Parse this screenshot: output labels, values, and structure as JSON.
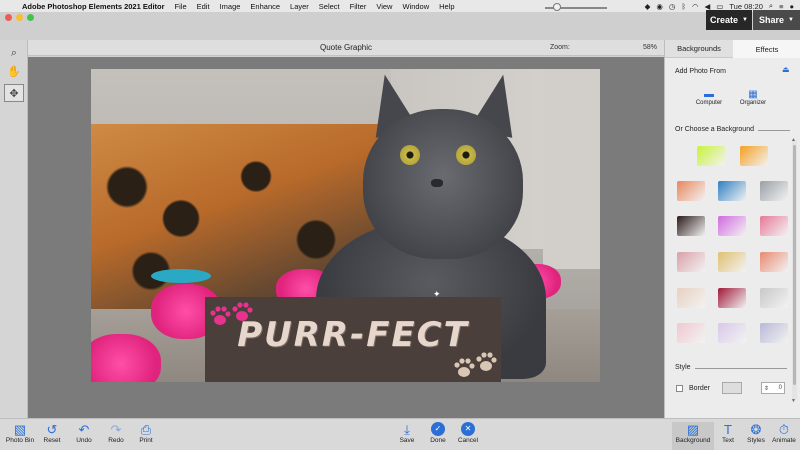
{
  "menubar": {
    "app": "Adobe Photoshop Elements 2021 Editor",
    "items": [
      "File",
      "Edit",
      "Image",
      "Enhance",
      "Layer",
      "Select",
      "Filter",
      "View",
      "Window",
      "Help"
    ],
    "clock": "Tue 08:20",
    "icons": [
      "apple-icon",
      "dropbox-icon",
      "record-icon",
      "clock-icon",
      "bluetooth-icon",
      "wifi-icon",
      "volume-icon",
      "battery-icon",
      "search-icon",
      "control-center-icon",
      "siri-icon"
    ]
  },
  "header": {
    "create_label": "Create",
    "share_label": "Share"
  },
  "document": {
    "title": "Quote Graphic",
    "zoom_label": "Zoom:",
    "zoom_value": "58%",
    "zoom_fraction": 0.58,
    "help": "?"
  },
  "canvas": {
    "quote_text": "PURR-FECT"
  },
  "panel": {
    "tabs": [
      "Backgrounds",
      "Effects"
    ],
    "add_photo_from": "Add Photo From",
    "computer_label": "Computer",
    "organizer_label": "Organizer",
    "choose_background": "Or Choose a Background",
    "style_label": "Style",
    "border_label": "Border",
    "border_value": "0",
    "thumbnail_colors": [
      [
        "#c9f23a",
        "#f5a020"
      ],
      [
        "#e8865a",
        "#2f7fc0",
        "#9aa0a6"
      ],
      [
        "#2a1a1a",
        "#d06ae0",
        "#e87898"
      ],
      [
        "#d9a0a8",
        "#e0c070",
        "#e88a70"
      ],
      [
        "#e8d0c0",
        "#a01838",
        "#c8c8c8"
      ],
      [
        "#f0c8d0",
        "#d8c8e8",
        "#b8b8d8"
      ]
    ]
  },
  "bottom": {
    "left": [
      "Photo Bin",
      "Reset",
      "Undo",
      "Redo",
      "Print"
    ],
    "center": [
      "Save",
      "Done",
      "Cancel"
    ],
    "right": [
      "Background",
      "Text",
      "Styles",
      "Animate"
    ]
  }
}
